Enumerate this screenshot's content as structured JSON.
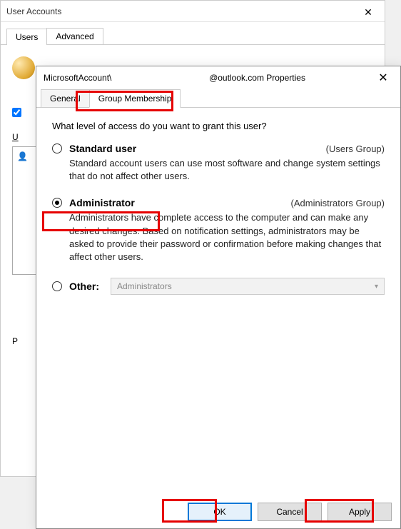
{
  "bgWindow": {
    "title": "User Accounts",
    "tabs": [
      "Users",
      "Advanced"
    ],
    "uLabel": "U",
    "pLabel": "P"
  },
  "dialog": {
    "titlePrefix": "MicrosoftAccount\\",
    "titleSuffix": "@outlook.com Properties",
    "tabs": {
      "general": "General",
      "membership": "Group Membership"
    },
    "prompt": "What level of access do you want to grant this user?",
    "options": {
      "standard": {
        "label": "Standard user",
        "group": "(Users Group)",
        "desc": "Standard account users can use most software and change system settings that do not affect other users."
      },
      "admin": {
        "label": "Administrator",
        "group": "(Administrators Group)",
        "desc": "Administrators have complete access to the computer and can make any desired changes. Based on notification settings, administrators may be asked to provide their password or confirmation before making changes that affect other users."
      },
      "other": {
        "label": "Other:",
        "selectValue": "Administrators"
      }
    },
    "buttons": {
      "ok": "OK",
      "cancel": "Cancel",
      "apply": "Apply"
    }
  }
}
